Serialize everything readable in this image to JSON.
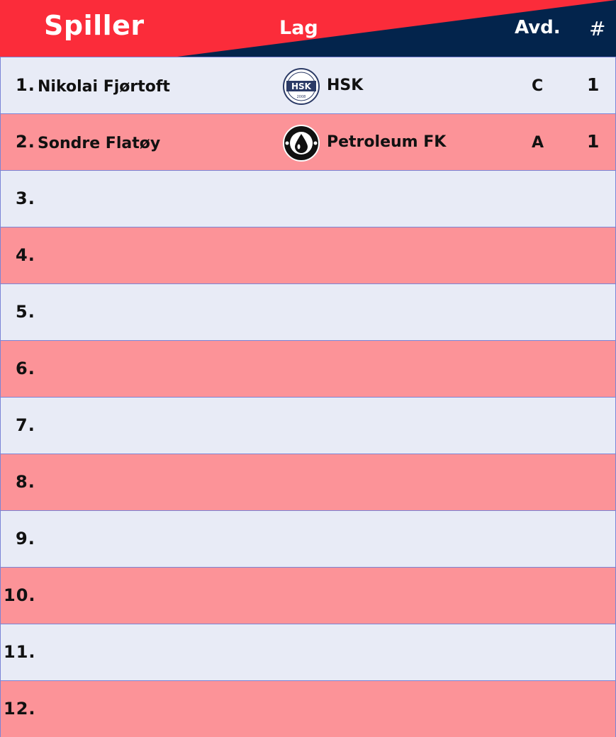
{
  "colors": {
    "header_red": "#fb2c3a",
    "header_navy": "#03244c",
    "row_light": "#e8ebf6",
    "row_pink": "#fc9398",
    "row_border": "#7a84d6"
  },
  "header": {
    "spiller": "Spiller",
    "lag": "Lag",
    "avd": "Avd.",
    "count": "#"
  },
  "rows": [
    {
      "rank": "1.",
      "player": "Nikolai Fjørtoft",
      "team": "HSK",
      "logo": "hsk-logo",
      "avd": "C",
      "count": "1"
    },
    {
      "rank": "2.",
      "player": "Sondre Flatøy",
      "team": "Petroleum FK",
      "logo": "petroleum-fk-logo",
      "avd": "A",
      "count": "1"
    },
    {
      "rank": "3.",
      "player": "",
      "team": "",
      "avd": "",
      "count": ""
    },
    {
      "rank": "4.",
      "player": "",
      "team": "",
      "avd": "",
      "count": ""
    },
    {
      "rank": "5.",
      "player": "",
      "team": "",
      "avd": "",
      "count": ""
    },
    {
      "rank": "6.",
      "player": "",
      "team": "",
      "avd": "",
      "count": ""
    },
    {
      "rank": "7.",
      "player": "",
      "team": "",
      "avd": "",
      "count": ""
    },
    {
      "rank": "8.",
      "player": "",
      "team": "",
      "avd": "",
      "count": ""
    },
    {
      "rank": "9.",
      "player": "",
      "team": "",
      "avd": "",
      "count": ""
    },
    {
      "rank": "10.",
      "player": "",
      "team": "",
      "avd": "",
      "count": ""
    },
    {
      "rank": "11.",
      "player": "",
      "team": "",
      "avd": "",
      "count": ""
    },
    {
      "rank": "12.",
      "player": "",
      "team": "",
      "avd": "",
      "count": ""
    }
  ]
}
